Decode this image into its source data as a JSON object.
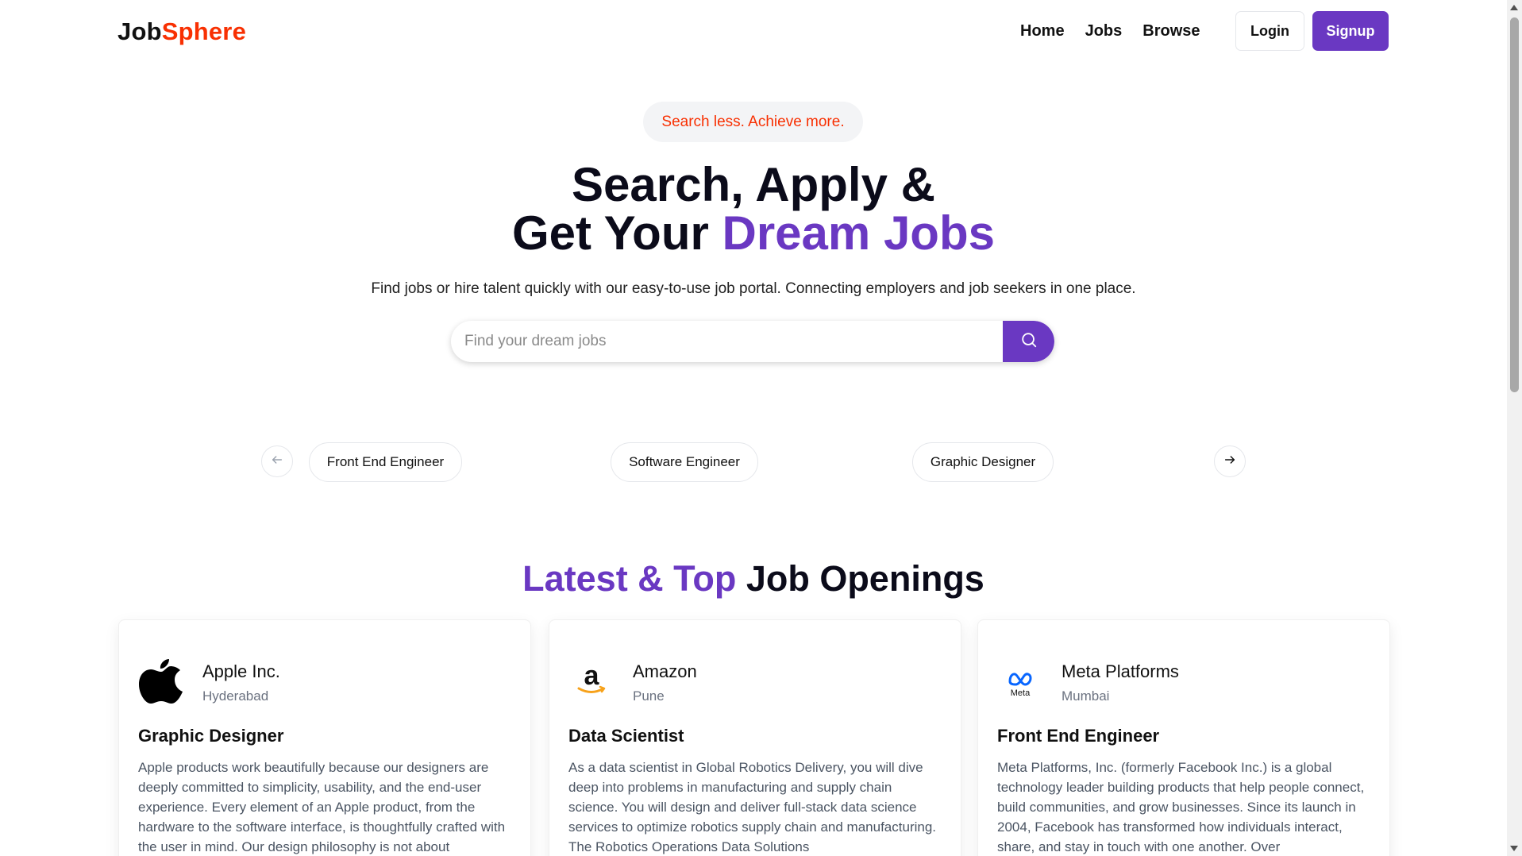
{
  "header": {
    "logo_part1": "Job",
    "logo_part2": "Sphere",
    "nav": [
      {
        "label": "Home"
      },
      {
        "label": "Jobs"
      },
      {
        "label": "Browse"
      }
    ],
    "login_label": "Login",
    "signup_label": "Signup"
  },
  "hero": {
    "tagline": "Search less. Achieve more.",
    "title_line1": "Search, Apply &",
    "title_line2_prefix": "Get Your ",
    "title_line2_accent": "Dream Jobs",
    "description": "Find jobs or hire talent quickly with our easy-to-use job portal. Connecting employers and job seekers in one place.",
    "search_placeholder": "Find your dream jobs",
    "search_icon": "search-icon"
  },
  "categories": {
    "items": [
      {
        "label": "Front End Engineer"
      },
      {
        "label": "Software Engineer"
      },
      {
        "label": "Graphic Designer"
      }
    ],
    "prev_icon": "arrow-left-icon",
    "next_icon": "arrow-right-icon"
  },
  "section": {
    "title_accent": "Latest & Top",
    "title_rest": " Job Openings"
  },
  "jobs": [
    {
      "company": "Apple Inc.",
      "location": "Hyderabad",
      "title": "Graphic Designer",
      "description": "Apple products work beautifully because our designers are deeply committed to simplicity, usability, and the end-user experience. Every element of an Apple product, from the hardware to the software interface, is thoughtfully crafted with the user in mind. Our design philosophy is not about",
      "logo_icon": "apple-logo-icon"
    },
    {
      "company": "Amazon",
      "location": "Pune",
      "title": "Data Scientist",
      "description": "As a data scientist in Global Robotics Delivery, you will dive deep into problems in manufacturing and supply chain science. You will design and deliver full-stack data science services to optimize robotics supply chain and manufacturing. The Robotics Operations Data Solutions",
      "logo_icon": "amazon-logo-icon"
    },
    {
      "company": "Meta Platforms",
      "location": "Mumbai",
      "title": "Front End Engineer",
      "description": "Meta Platforms, Inc. (formerly Facebook Inc.) is a global technology leader building products that help people connect, build communities, and grow businesses. Since its launch in 2004, Facebook has transformed how individuals interact, share, and stay in touch with one another. Over",
      "logo_icon": "meta-logo-icon",
      "logo_text": "Meta"
    }
  ],
  "colors": {
    "accent": "#6a38c2",
    "brand_red": "#f83002"
  }
}
